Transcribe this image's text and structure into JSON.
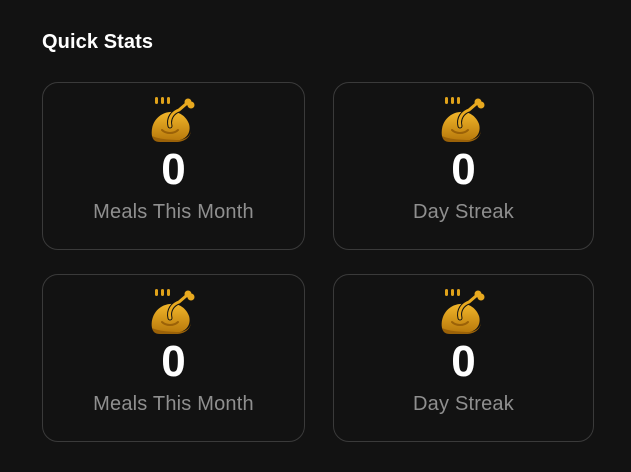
{
  "section": {
    "title": "Quick Stats"
  },
  "stats": [
    {
      "icon": "roast-chicken-icon",
      "value": "0",
      "label": "Meals This Month"
    },
    {
      "icon": "roast-chicken-icon",
      "value": "0",
      "label": "Day Streak"
    },
    {
      "icon": "roast-chicken-icon",
      "value": "0",
      "label": "Meals This Month"
    },
    {
      "icon": "roast-chicken-icon",
      "value": "0",
      "label": "Day Streak"
    }
  ],
  "colors": {
    "background": "#121212",
    "card_border": "#3a3a3a",
    "value_text": "#ffffff",
    "label_text": "#8f8f8f",
    "icon_gold": "#e0a21a",
    "icon_dark": "#9b6208"
  }
}
